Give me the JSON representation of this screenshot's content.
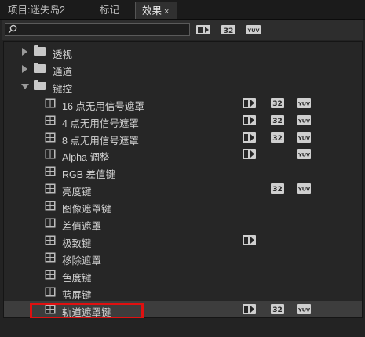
{
  "tabs": [
    {
      "label": "项目:迷失岛2"
    },
    {
      "label": "标记"
    },
    {
      "label": "效果",
      "close": "×"
    }
  ],
  "search": {
    "value": "",
    "placeholder": ""
  },
  "colors": {
    "panel_bg": "#232323",
    "highlight_border": "#e01010"
  },
  "tree": [
    {
      "label": "透视",
      "type": "folder",
      "state": "collapsed"
    },
    {
      "label": "通道",
      "type": "folder",
      "state": "collapsed"
    },
    {
      "label": "键控",
      "type": "folder",
      "state": "expanded"
    },
    {
      "label": "16 点无用信号遮罩",
      "type": "effect",
      "accel": true,
      "b32": true,
      "yuv": true
    },
    {
      "label": "4 点无用信号遮罩",
      "type": "effect",
      "accel": true,
      "b32": true,
      "yuv": true
    },
    {
      "label": "8 点无用信号遮罩",
      "type": "effect",
      "accel": true,
      "b32": true,
      "yuv": true
    },
    {
      "label": "Alpha 调整",
      "type": "effect",
      "accel": true,
      "b32": false,
      "yuv": true
    },
    {
      "label": "RGB 差值键",
      "type": "effect",
      "accel": false,
      "b32": false,
      "yuv": false
    },
    {
      "label": "亮度键",
      "type": "effect",
      "accel": false,
      "b32": true,
      "yuv": true
    },
    {
      "label": "图像遮罩键",
      "type": "effect",
      "accel": false,
      "b32": false,
      "yuv": false
    },
    {
      "label": "差值遮罩",
      "type": "effect",
      "accel": false,
      "b32": false,
      "yuv": false
    },
    {
      "label": "极致键",
      "type": "effect",
      "accel": true,
      "b32": false,
      "yuv": false
    },
    {
      "label": "移除遮罩",
      "type": "effect",
      "accel": false,
      "b32": false,
      "yuv": false
    },
    {
      "label": "色度键",
      "type": "effect",
      "accel": false,
      "b32": false,
      "yuv": false
    },
    {
      "label": "蓝屏键",
      "type": "effect",
      "accel": false,
      "b32": false,
      "yuv": false
    },
    {
      "label": "轨道遮罩键",
      "type": "effect",
      "accel": true,
      "b32": true,
      "yuv": true,
      "selected": true
    }
  ]
}
